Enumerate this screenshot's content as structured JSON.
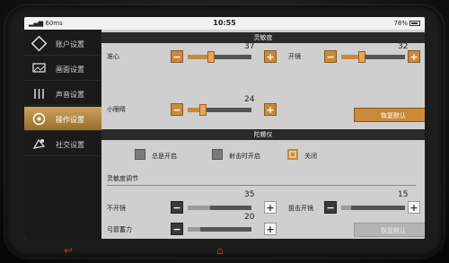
{
  "status": {
    "signal": "60ms",
    "time": "10:55",
    "battery": "78%"
  },
  "sidebar": {
    "items": [
      {
        "label": "账户设置",
        "icon": "account-icon",
        "active": false
      },
      {
        "label": "画面设置",
        "icon": "display-icon",
        "active": false
      },
      {
        "label": "声音设置",
        "icon": "sound-icon",
        "active": false
      },
      {
        "label": "操作设置",
        "icon": "controls-icon",
        "active": true
      },
      {
        "label": "社交设置",
        "icon": "social-icon",
        "active": false
      }
    ]
  },
  "sensitivity": {
    "title": "灵敏度",
    "sliders": [
      {
        "label": "准心",
        "value": "37",
        "level": 0.37
      },
      {
        "label": "开镜",
        "value": "32",
        "level": 0.32
      },
      {
        "label": "小眼睛",
        "value": "24",
        "level": 0.24
      }
    ],
    "reset_label": "恢复默认"
  },
  "gyro": {
    "title": "陀螺仪",
    "options": [
      {
        "label": "总是开启",
        "checked": false
      },
      {
        "label": "射击时开启",
        "checked": false
      },
      {
        "label": "关闭",
        "checked": true
      }
    ],
    "sub_title": "灵敏度调节",
    "sliders": [
      {
        "label": "不开镜",
        "value": "35",
        "level": 0.35
      },
      {
        "label": "狙击开镜",
        "value": "15",
        "level": 0.15
      },
      {
        "label": "弓箭蓄力",
        "value": "20",
        "level": 0.2
      }
    ],
    "reset_label": "恢复默认"
  },
  "buttons": {
    "minus": "−",
    "plus": "+"
  },
  "nav": {
    "back": "↩",
    "home": "⌂"
  },
  "colors": {
    "accent": "#c98a3a",
    "sidebar_bg": "#1a1a1a",
    "panel_bg": "#cfcfcf"
  }
}
